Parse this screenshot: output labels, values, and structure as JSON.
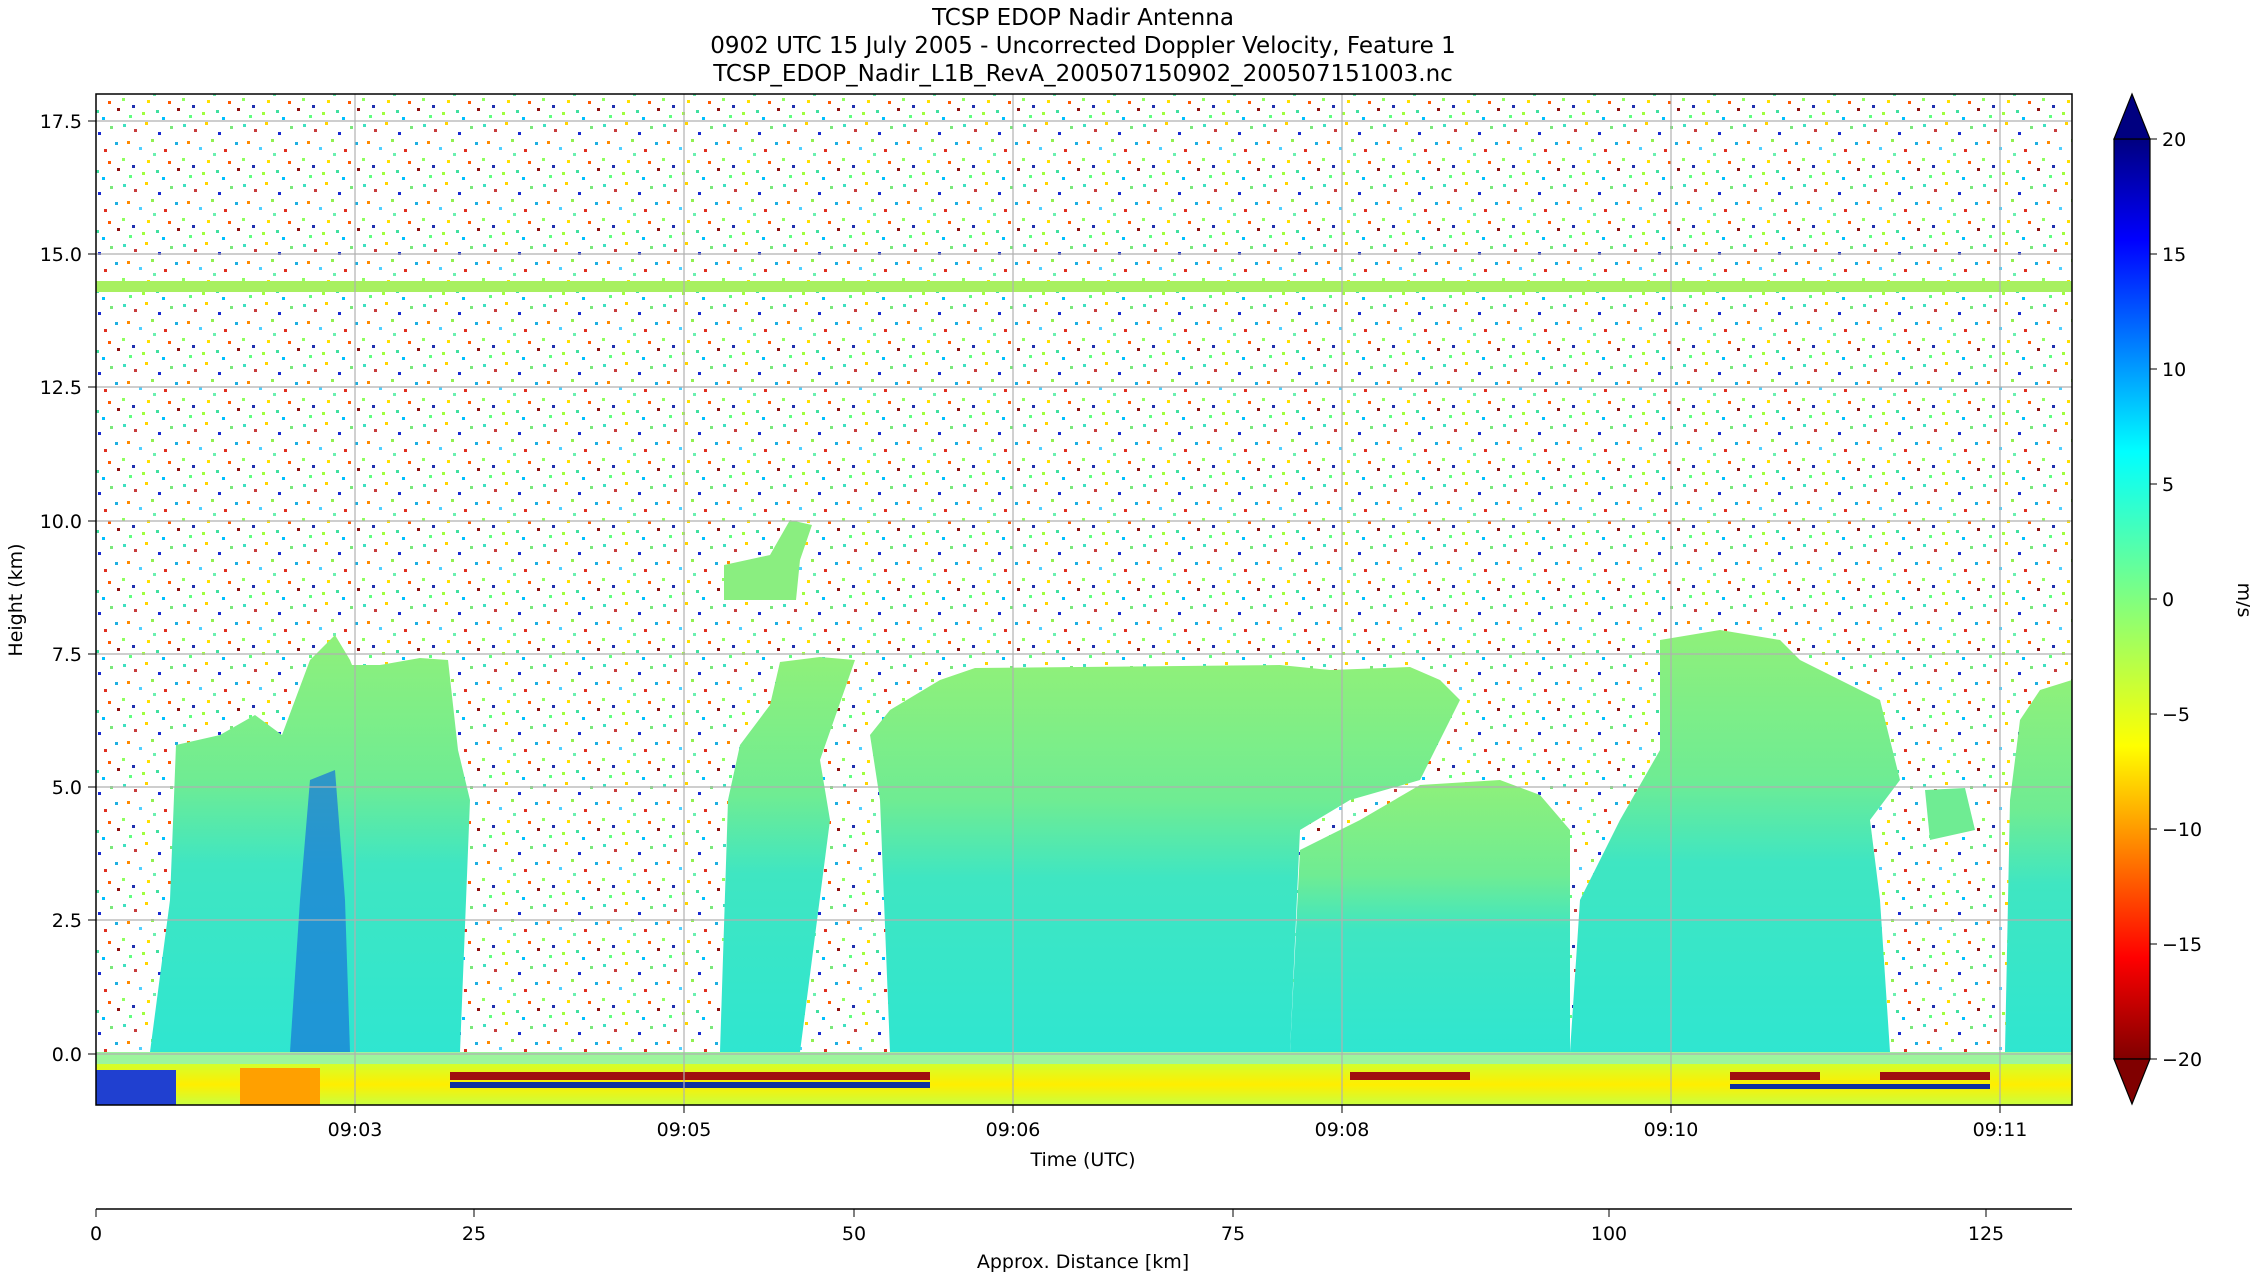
{
  "chart_data": {
    "type": "heatmap",
    "title": "TCSP EDOP Nadir Antenna",
    "subtitle": "0902 UTC 15 July 2005 - Uncorrected Doppler Velocity, Feature 1",
    "filename": "TCSP_EDOP_Nadir_L1B_RevA_200507150902_200507151003.nc",
    "xlabel": "Time (UTC)",
    "ylabel": "Height (km)",
    "x2label": "Approx. Distance [km]",
    "colorbar_label": "m/s",
    "x_ticks": [
      "09:03",
      "09:05",
      "09:06",
      "09:08",
      "09:10",
      "09:11"
    ],
    "y_ticks": [
      "17.5",
      "15.0",
      "12.5",
      "10.0",
      "7.5",
      "5.0",
      "2.5",
      "0.0"
    ],
    "x2_ticks": [
      "0",
      "25",
      "50",
      "75",
      "100",
      "125"
    ],
    "colorbar_ticks": [
      "20",
      "15",
      "10",
      "5",
      "0",
      "−15",
      "−10",
      "−5",
      "−20"
    ],
    "ylim": [
      -1.0,
      18.0
    ],
    "x2lim": [
      0,
      131
    ],
    "clim": [
      -20,
      20
    ],
    "colormap": "jet",
    "colorbar_extend": "both",
    "grid": true,
    "features": {
      "bright_band_km": 14.4,
      "surface_km": 0.0,
      "cloud_segments_km": [
        {
          "x_start": 5,
          "x_end": 25,
          "top": 6.0,
          "top_peak": 7.9
        },
        {
          "x_start": 41,
          "x_end": 48,
          "top": 7.4
        },
        {
          "x_start": 52,
          "x_end": 88,
          "top": 7.2
        },
        {
          "x_start": 88,
          "x_end": 103,
          "top": 5.0
        },
        {
          "x_start": 103,
          "x_end": 118,
          "top": 7.8
        },
        {
          "x_start": 126,
          "x_end": 131,
          "top": 7.1
        }
      ],
      "elevated_echo": {
        "x": 45,
        "height_km": [
          8.7,
          9.9
        ]
      }
    }
  },
  "colors": {
    "grid": "#b0b0b0",
    "colormap_stops": [
      "#800000",
      "#ff0000",
      "#ff8000",
      "#ffff00",
      "#80ff80",
      "#00ffff",
      "#0080ff",
      "#0000ff",
      "#000080"
    ]
  }
}
